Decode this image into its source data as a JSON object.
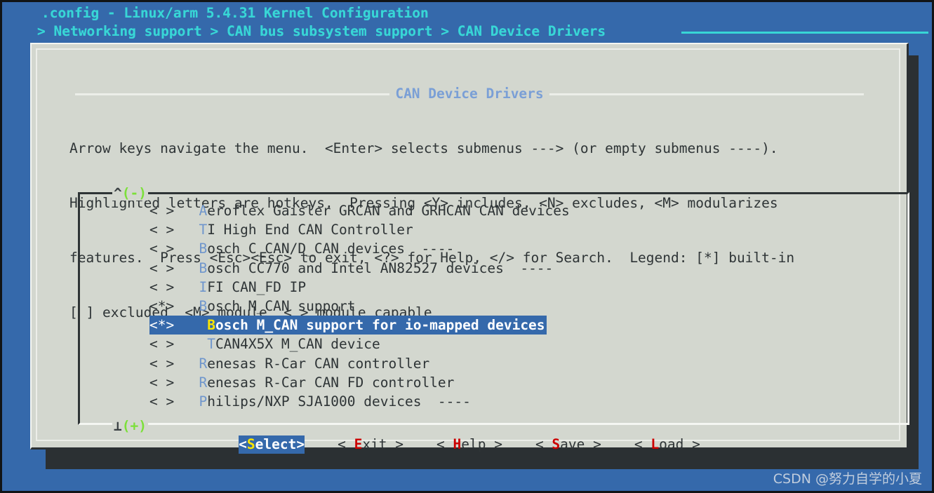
{
  "terminal": {
    "title": ".config - Linux/arm 5.4.31 Kernel Configuration",
    "breadcrumb": "> Networking support > CAN bus subsystem support > CAN Device Drivers",
    "bg_color": "#3569ab",
    "fg_color": "#38d6d6"
  },
  "dialog": {
    "title": "CAN Device Drivers",
    "title_color": "#7a9fd6",
    "bg_color": "#d3d7cf",
    "help_lines": [
      "Arrow keys navigate the menu.  <Enter> selects submenus ---> (or empty submenus ----).",
      "Highlighted letters are hotkeys.  Pressing <Y> includes, <N> excludes, <M> modularizes",
      "features.  Press <Esc><Esc> to exit, <?> for Help, </> for Search.  Legend: [*] built-in",
      "[ ] excluded  <M> module  < > module capable"
    ]
  },
  "listbox": {
    "scroll_up_indicator": "^(-)",
    "scroll_down_indicator": "⊥(+)",
    "scroll_indicator_color": "#7ce03a",
    "items": [
      {
        "state": "< >",
        "indent": 0,
        "hotkey": "A",
        "label": "eroflex Gaisler GRCAN and GRHCAN CAN devices",
        "suffix": "",
        "selected": false
      },
      {
        "state": "< >",
        "indent": 0,
        "hotkey": "T",
        "label": "I High End CAN Controller",
        "suffix": "",
        "selected": false
      },
      {
        "state": "< >",
        "indent": 0,
        "hotkey": "B",
        "label": "osch C_CAN/D_CAN devices",
        "suffix": "  ----",
        "selected": false
      },
      {
        "state": "< >",
        "indent": 0,
        "hotkey": "B",
        "label": "osch CC770 and Intel AN82527 devices",
        "suffix": "  ----",
        "selected": false
      },
      {
        "state": "< >",
        "indent": 0,
        "hotkey": "I",
        "label": "FI CAN_FD IP",
        "suffix": "",
        "selected": false
      },
      {
        "state": "<*>",
        "indent": 0,
        "hotkey": "B",
        "label": "osch M_CAN support",
        "suffix": "",
        "selected": false
      },
      {
        "state": "<*>",
        "indent": 1,
        "hotkey": "B",
        "label": "osch M_CAN support for io-mapped devices",
        "suffix": "",
        "selected": true
      },
      {
        "state": "< >",
        "indent": 1,
        "hotkey": "T",
        "label": "CAN4X5X M_CAN device",
        "suffix": "",
        "selected": false
      },
      {
        "state": "< >",
        "indent": 0,
        "hotkey": "R",
        "label": "enesas R-Car CAN controller",
        "suffix": "",
        "selected": false
      },
      {
        "state": "< >",
        "indent": 0,
        "hotkey": "R",
        "label": "enesas R-Car CAN FD controller",
        "suffix": "",
        "selected": false
      },
      {
        "state": "< >",
        "indent": 0,
        "hotkey": "P",
        "label": "hilips/NXP SJA1000 devices",
        "suffix": "  ----",
        "selected": false
      }
    ]
  },
  "buttons": [
    {
      "open": "<",
      "hotkey": "S",
      "rest": "elect",
      "close": ">",
      "label": "<Select>",
      "active": true
    },
    {
      "open": "< ",
      "hotkey": "E",
      "rest": "xit",
      "close": " >",
      "label": "< Exit >",
      "active": false
    },
    {
      "open": "< ",
      "hotkey": "H",
      "rest": "elp",
      "close": " >",
      "label": "< Help >",
      "active": false
    },
    {
      "open": "< ",
      "hotkey": "S",
      "rest": "ave",
      "close": " >",
      "label": "< Save >",
      "active": false
    },
    {
      "open": "< ",
      "hotkey": "L",
      "rest": "oad",
      "close": " >",
      "label": "< Load >",
      "active": false
    }
  ],
  "watermark": "CSDN @努力自学的小夏"
}
